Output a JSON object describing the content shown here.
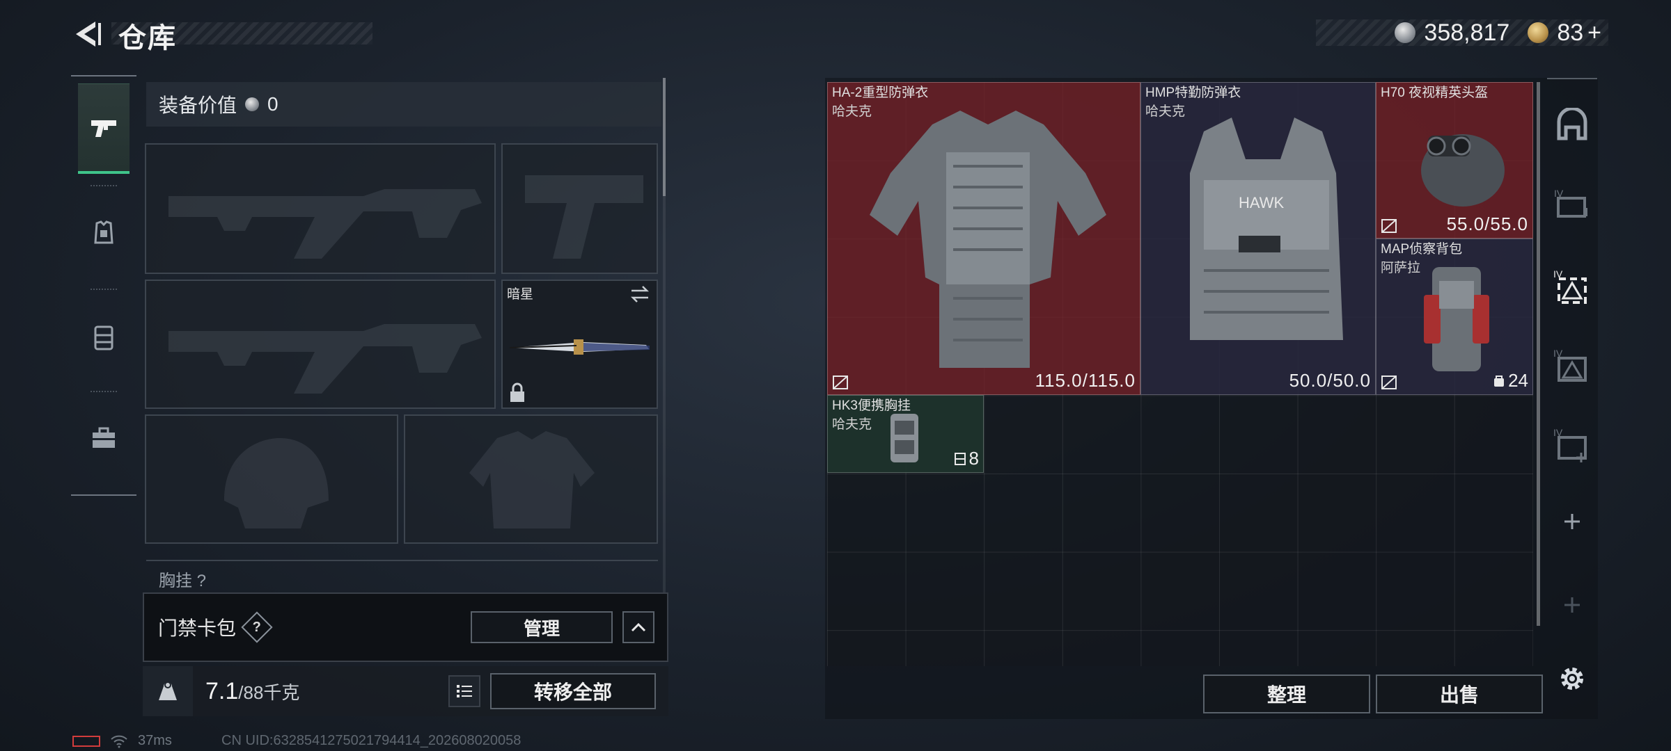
{
  "header": {
    "title": "仓库",
    "currency": {
      "silver": "358,817",
      "gold": "83"
    }
  },
  "left_tabs": [
    {
      "name": "weapons",
      "icon": "gun-icon",
      "active": true
    },
    {
      "name": "armor",
      "icon": "vest-icon",
      "active": false
    },
    {
      "name": "backpack",
      "icon": "backpack-icon",
      "active": false
    },
    {
      "name": "supplies",
      "icon": "toolbox-icon",
      "active": false
    }
  ],
  "loadout": {
    "equip_value_label": "装备价值",
    "equip_value": "0",
    "melee_name": "暗星",
    "chest_partial_label": "胸挂",
    "keycard_label": "门禁卡包",
    "help": "?",
    "manage_label": "管理",
    "weight_current": "7.1",
    "weight_max": "/88千克",
    "transfer_all_label": "转移全部"
  },
  "inventory": {
    "items": [
      {
        "name": "HA-2重型防弹衣",
        "brand": "哈夫克",
        "durability": "115.0/115.0",
        "rarity_color": "#7a2228"
      },
      {
        "name": "HMP特勤防弹衣",
        "brand": "哈夫克",
        "durability": "50.0/50.0",
        "rarity_color": "#28283e"
      },
      {
        "name": "H70 夜视精英头盔",
        "brand": "",
        "durability": "55.0/55.0",
        "rarity_color": "#7a2228"
      },
      {
        "name": "MAP侦察背包",
        "brand": "阿萨拉",
        "capacity": "24",
        "rarity_color": "#28283e"
      },
      {
        "name": "HK3便携胸挂",
        "brand": "哈夫克",
        "capacity": "8",
        "rarity_color": "#1e342c"
      }
    ],
    "sort_label": "整理",
    "sell_label": "出售"
  },
  "status": {
    "ping": "37ms",
    "uid": "CN UID:6328541275021794414_202608020058"
  }
}
